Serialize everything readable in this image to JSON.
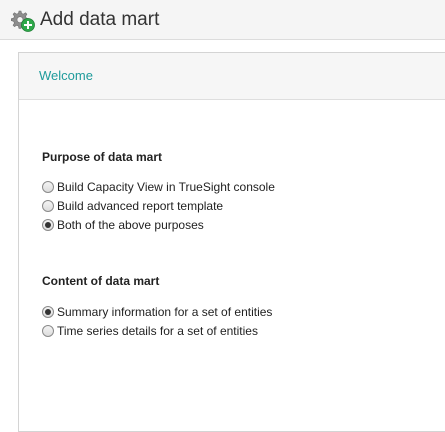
{
  "header": {
    "title": "Add data mart",
    "icon": "gear-add-icon",
    "icon_badge_color": "#2ea84a"
  },
  "panel": {
    "title": "Welcome",
    "title_color": "#1e9b9b"
  },
  "purpose": {
    "heading": "Purpose of data mart",
    "options": [
      {
        "label": "Build Capacity View in TrueSight console",
        "checked": false
      },
      {
        "label": "Build advanced report template",
        "checked": false
      },
      {
        "label": "Both of the above purposes",
        "checked": true
      }
    ]
  },
  "content": {
    "heading": "Content of data mart",
    "options": [
      {
        "label": "Summary information for a set of entities",
        "checked": true
      },
      {
        "label": "Time series details for a set of entities",
        "checked": false
      }
    ]
  }
}
